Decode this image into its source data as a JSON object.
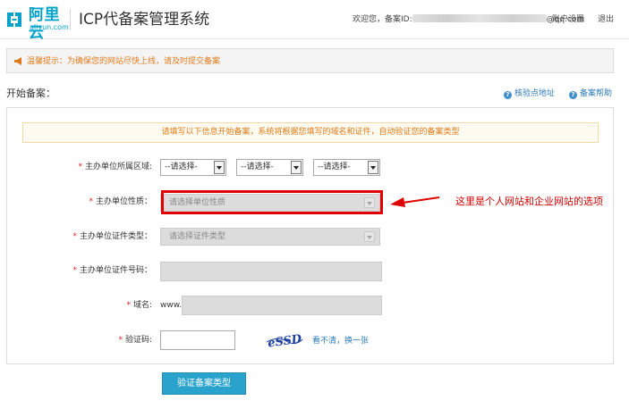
{
  "header": {
    "logo_text": "阿里云",
    "logo_sub": "aliyun.com",
    "system_title": "ICP代备案管理系统",
    "welcome_prefix": "欢迎您，备案ID:",
    "user_suffix": "@qq.com",
    "account_settings": "账户设置",
    "logout": "退出"
  },
  "notice": {
    "text": "温馨提示：为确保您的网站尽快上线，请及时提交备案"
  },
  "section": {
    "title": "开始备案：",
    "link_verify": "核验点地址",
    "link_help": "备案帮助"
  },
  "form": {
    "tip": "请填写以下信息开始备案，系统将根据您填写的域名和证件，自动验证您的备案类型",
    "required_mark": "*",
    "region": {
      "label": "主办单位所属区域:",
      "select1": "--请选择-",
      "select2": "--请选择-",
      "select3": "--请选择-"
    },
    "nature": {
      "label": "主办单位性质：",
      "placeholder": "请选择单位性质"
    },
    "cert_type": {
      "label": "主办单位证件类型：",
      "placeholder": "请选择证件类型"
    },
    "cert_number": {
      "label": "主办单位证件号码："
    },
    "domain": {
      "label": "域名:",
      "prefix": "www."
    },
    "captcha": {
      "label": "验证码:",
      "image_text": "eSSD",
      "refresh": "看不清，换一张"
    },
    "submit": "验证备案类型"
  },
  "annotation": {
    "text": "这里是个人网站和企业网站的选项",
    "color": "#e00000"
  },
  "colors": {
    "accent": "#00a2ca",
    "link": "#2d7ab8",
    "warning_text": "#e07b1a",
    "submit_bg": "#2aa3cc"
  }
}
